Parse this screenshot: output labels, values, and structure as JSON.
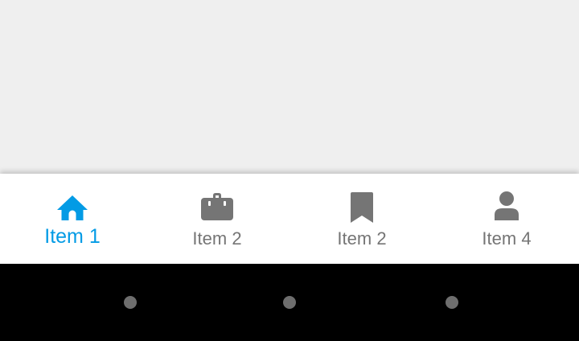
{
  "colors": {
    "active": "#039be5",
    "inactive": "#757575",
    "content_bg": "#efefef",
    "nav_bg": "#ffffff",
    "system_bar_bg": "#000000",
    "system_dot": "#6e6e6e"
  },
  "bottom_nav": {
    "items": [
      {
        "label": "Item 1",
        "icon": "home-icon",
        "active": true
      },
      {
        "label": "Item 2",
        "icon": "briefcase-icon",
        "active": false
      },
      {
        "label": "Item 2",
        "icon": "bookmark-icon",
        "active": false
      },
      {
        "label": "Item 4",
        "icon": "person-icon",
        "active": false
      }
    ]
  },
  "system_bar": {
    "buttons": [
      "back-button",
      "home-button",
      "recents-button"
    ]
  }
}
